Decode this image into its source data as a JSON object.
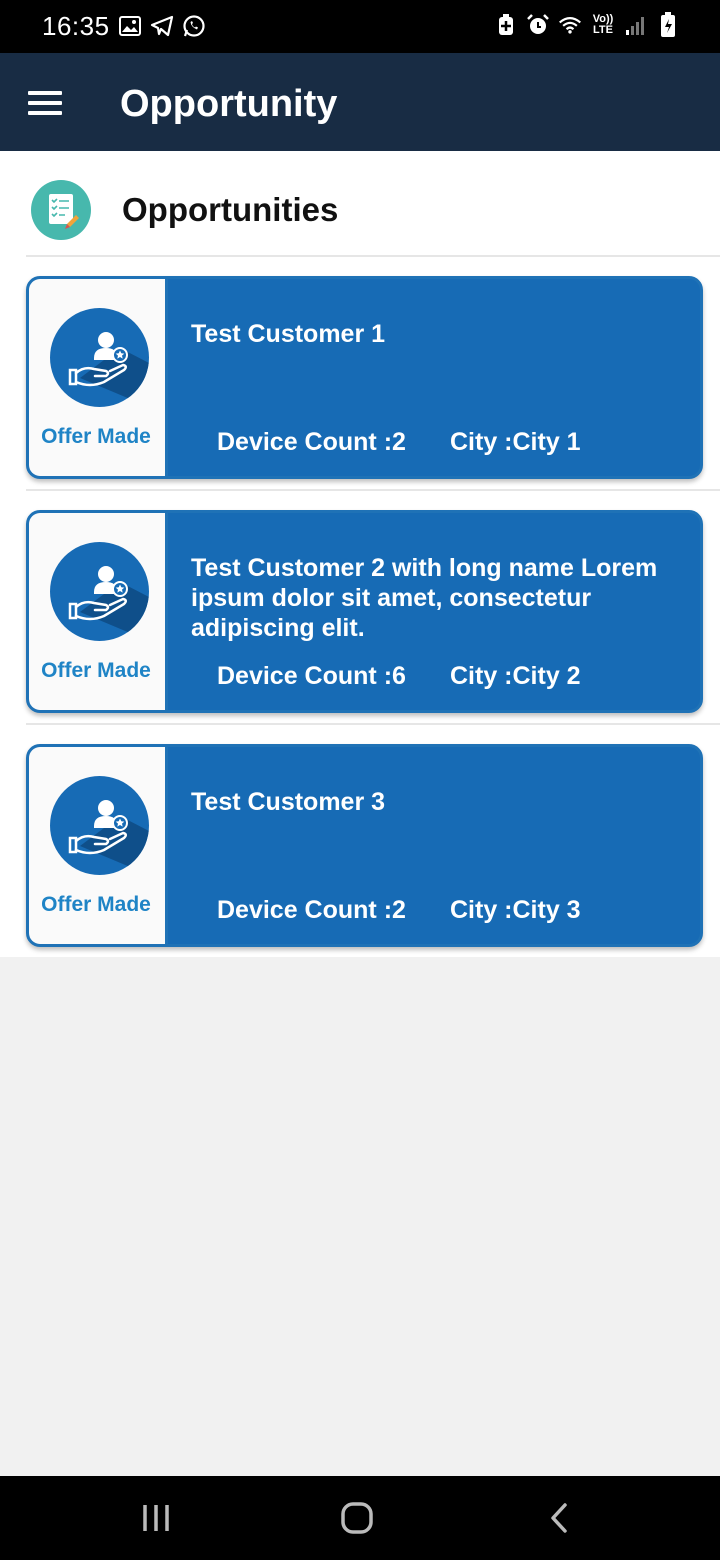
{
  "status_bar": {
    "time": "16:35",
    "left_icons": [
      "image-icon",
      "telegram-icon",
      "whatsapp-icon"
    ],
    "right_icons": [
      "battery-saver-icon",
      "alarm-icon",
      "wifi-icon",
      "volte-icon",
      "signal-icon",
      "battery-icon"
    ],
    "volte_top": "Vo))",
    "volte_bottom": "LTE"
  },
  "app_bar": {
    "title": "Opportunity",
    "menu_icon": "hamburger-menu-icon"
  },
  "section": {
    "title": "Opportunities",
    "icon": "checklist-icon"
  },
  "opportunities": [
    {
      "customer": "Test Customer 1",
      "status": "Offer Made",
      "device_count": "Device Count :2",
      "city": "City :City 1"
    },
    {
      "customer": "Test Customer 2 with long name Lorem ipsum dolor sit amet, consectetur adipiscing elit.",
      "status": "Offer Made",
      "device_count": "Device Count :6",
      "city": "City :City 2"
    },
    {
      "customer": "Test Customer 3",
      "status": "Offer Made",
      "device_count": "Device Count :2",
      "city": "City :City 3"
    }
  ],
  "nav_bar": {
    "icons": [
      "recent-apps-icon",
      "home-icon",
      "back-icon"
    ]
  },
  "colors": {
    "app_bar": "#182c44",
    "card": "#176bb5",
    "status_text": "#1f84c6",
    "section_icon": "#47b8ad"
  }
}
